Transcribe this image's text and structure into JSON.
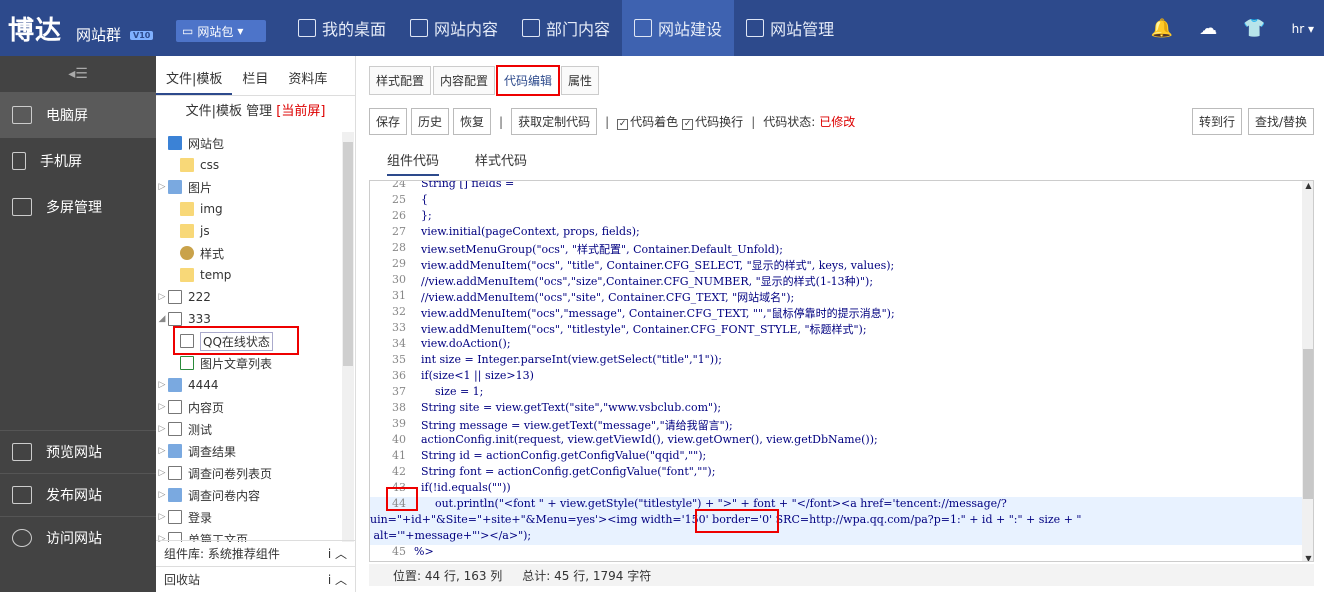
{
  "topbar": {
    "logo": "博达",
    "logo_sub": "网站群",
    "logo_ver": "V10",
    "site_select": "网站包",
    "nav": [
      "我的桌面",
      "网站内容",
      "部门内容",
      "网站建设",
      "网站管理"
    ],
    "user": "hr"
  },
  "sidebar": {
    "items": [
      "电脑屏",
      "手机屏",
      "多屏管理"
    ],
    "bottom": [
      "预览网站",
      "发布网站",
      "访问网站"
    ]
  },
  "tree": {
    "tabs": [
      "文件|模板",
      "栏目",
      "资料库"
    ],
    "title_prefix": "文件|模板 管理",
    "title_flag": "[当前屏]",
    "rows": [
      "网站包",
      "css",
      "图片",
      "img",
      "js",
      "样式",
      "temp",
      "222",
      "333",
      "QQ在线状态",
      "图片文章列表",
      "4444",
      "内容页",
      "测试",
      "调查结果",
      "调查问卷列表页",
      "调查问卷内容",
      "登录",
      "单篇工文页"
    ],
    "footer1": "组件库: 系统推荐组件",
    "footer2": "回收站"
  },
  "main": {
    "tabs": [
      "样式配置",
      "内容配置",
      "代码编辑",
      "属性"
    ],
    "toolbar": {
      "save": "保存",
      "history": "历史",
      "restore": "恢复",
      "get_code": "获取定制代码",
      "color": "代码着色",
      "wrap": "代码换行",
      "status_label": "代码状态:",
      "status_value": "已修改",
      "goto": "转到行",
      "find": "查找/替换"
    },
    "subtabs": [
      "组件代码",
      "样式代码"
    ],
    "code": [
      {
        "n": "24",
        "t": "  String [] fields ="
      },
      {
        "n": "25",
        "t": "  {"
      },
      {
        "n": "26",
        "t": "  };"
      },
      {
        "n": "27",
        "t": "  view.initial(pageContext, props, fields);"
      },
      {
        "n": "28",
        "t": "  view.setMenuGroup(\"ocs\", \"样式配置\", Container.Default_Unfold);"
      },
      {
        "n": "29",
        "t": "  view.addMenuItem(\"ocs\", \"title\", Container.CFG_SELECT, \"显示的样式\", keys, values);"
      },
      {
        "n": "30",
        "t": "  //view.addMenuItem(\"ocs\",\"size\",Container.CFG_NUMBER, \"显示的样式(1-13种)\");"
      },
      {
        "n": "31",
        "t": "  //view.addMenuItem(\"ocs\",\"site\", Container.CFG_TEXT, \"网站域名\");"
      },
      {
        "n": "32",
        "t": "  view.addMenuItem(\"ocs\",\"message\", Container.CFG_TEXT, \"\",\"鼠标停靠时的提示消息\");"
      },
      {
        "n": "33",
        "t": "  view.addMenuItem(\"ocs\", \"titlestyle\", Container.CFG_FONT_STYLE, \"标题样式\");"
      },
      {
        "n": "34",
        "t": "  view.doAction();"
      },
      {
        "n": "35",
        "t": "  int size = Integer.parseInt(view.getSelect(\"title\",\"1\"));"
      },
      {
        "n": "36",
        "t": "  if(size<1 || size>13)"
      },
      {
        "n": "37",
        "t": "      size = 1;"
      },
      {
        "n": "38",
        "t": "  String site = view.getText(\"site\",\"www.vsbclub.com\");"
      },
      {
        "n": "39",
        "t": "  String message = view.getText(\"message\",\"请给我留言\");"
      },
      {
        "n": "40",
        "t": "  actionConfig.init(request, view.getViewId(), view.getOwner(), view.getDbName());"
      },
      {
        "n": "41",
        "t": "  String id = actionConfig.getConfigValue(\"qqid\",\"\");"
      },
      {
        "n": "42",
        "t": "  String font = actionConfig.getConfigValue(\"font\",\"\");"
      },
      {
        "n": "43",
        "t": "  if(!id.equals(\"\"))"
      },
      {
        "n": "44",
        "t": "      out.println(\"<font \" + view.getStyle(\"titlestyle\") + \">\" + font + \"</font><a href='tencent://message/?"
      },
      {
        "n": "",
        "t": "uin=\"+id+\"&Site=\"+site+\"&Menu=yes'><img width='150' border='0' SRC=http://wpa.qq.com/pa?p=1:\" + id + \":\" + size + \""
      },
      {
        "n": "",
        "t": " alt='\"+message+\"'></a>\");"
      },
      {
        "n": "45",
        "t": "%>"
      }
    ],
    "status_pos": "位置:   44 行, 163 列",
    "status_total": "总计:  45 行, 1794 字符"
  }
}
